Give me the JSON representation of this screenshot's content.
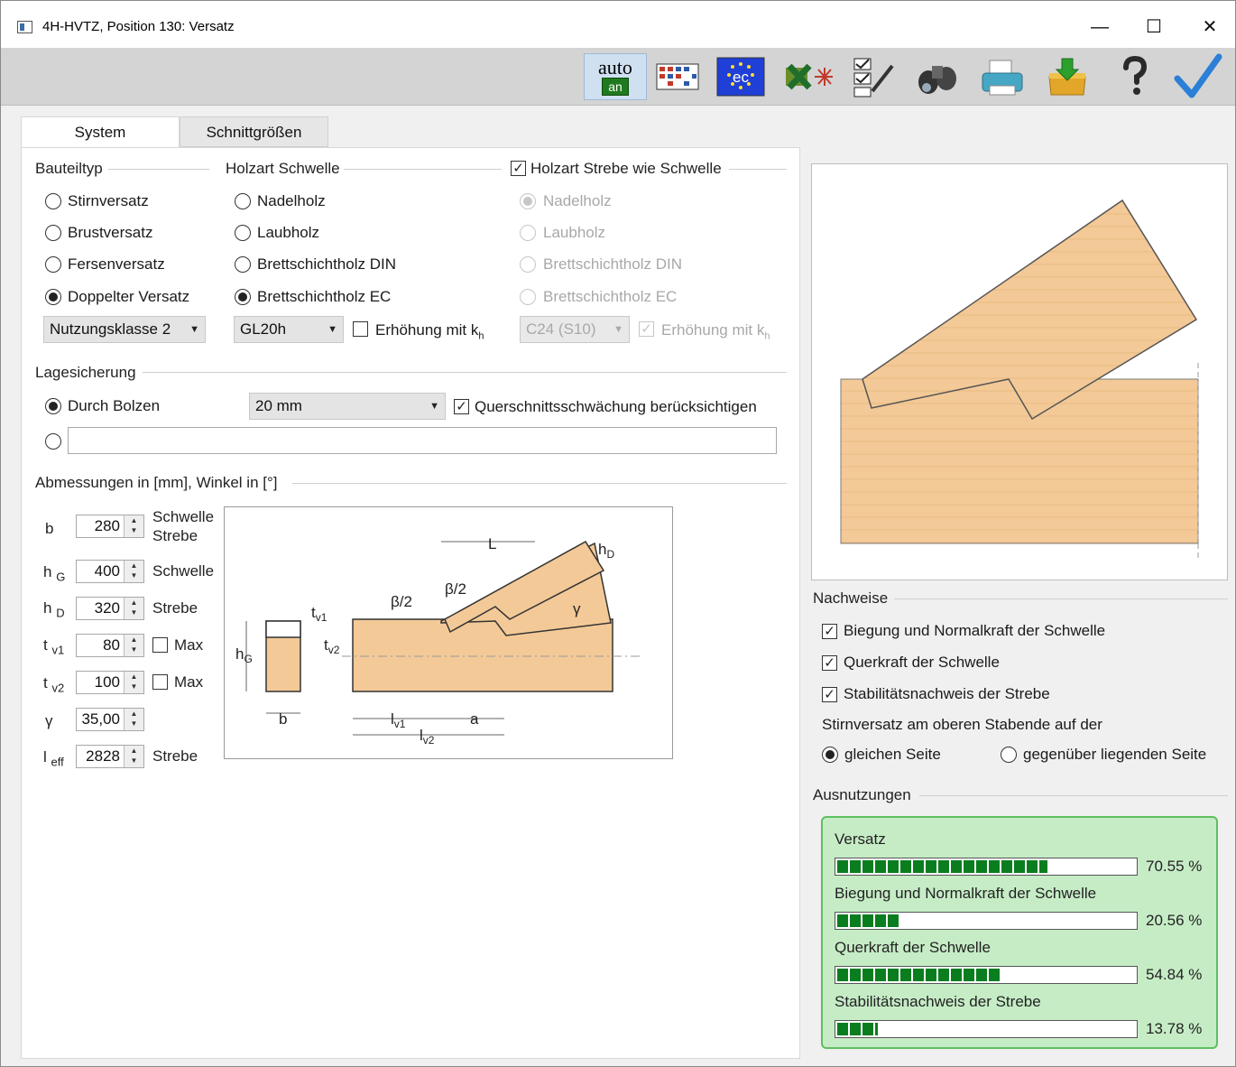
{
  "window": {
    "title": "4H-HVTZ, Position 130: Versatz",
    "min": "—",
    "max": "☐",
    "close": "✕"
  },
  "toolbar": {
    "auto_label": "auto",
    "an_label": "an",
    "icons": [
      "auto-toggle-icon",
      "grid-icon",
      "eurocode-icon",
      "export-icon",
      "checklist-icon",
      "binoculars-icon",
      "printer-icon",
      "save-icon",
      "help-icon",
      "ok-icon"
    ],
    "ec_label": "ec"
  },
  "tabs": {
    "system": "System",
    "schnittgroessen": "Schnittgrößen"
  },
  "bauteiltyp": {
    "label": "Bauteiltyp",
    "options": [
      "Stirnversatz",
      "Brustversatz",
      "Fersenversatz",
      "Doppelter Versatz"
    ],
    "selected": 3,
    "nutzungsklasse": "Nutzungsklasse 2"
  },
  "holzart_schwelle": {
    "label": "Holzart Schwelle",
    "options": [
      "Nadelholz",
      "Laubholz",
      "Brettschichtholz DIN",
      "Brettschichtholz EC"
    ],
    "selected": 3,
    "grade": "GL20h",
    "erhoehung": "Erhöhung mit k",
    "erhoehung_sub": "h"
  },
  "holzart_strebe": {
    "label": "Holzart Strebe wie Schwelle",
    "checked": true,
    "options": [
      "Nadelholz",
      "Laubholz",
      "Brettschichtholz DIN",
      "Brettschichtholz EC"
    ],
    "selected": 0,
    "grade": "C24 (S10)",
    "erhoehung": "Erhöhung mit k",
    "erhoehung_sub": "h"
  },
  "lagesicherung": {
    "label": "Lagesicherung",
    "option1": "Durch Bolzen",
    "bolt": "20 mm",
    "querschnitt": "Querschnittsschwächung berücksichtigen",
    "custom_value": ""
  },
  "abmessungen": {
    "label": "Abmessungen in [mm], Winkel in [°]",
    "rows": [
      {
        "symbol": "b",
        "sub": "",
        "value": "280",
        "note": "Schwelle\nStrebe"
      },
      {
        "symbol": "h",
        "sub": "G",
        "value": "400",
        "note": "Schwelle"
      },
      {
        "symbol": "h",
        "sub": "D",
        "value": "320",
        "note": "Strebe"
      },
      {
        "symbol": "t",
        "sub": "v1",
        "value": "80",
        "note": "Max"
      },
      {
        "symbol": "t",
        "sub": "v2",
        "value": "100",
        "note": "Max"
      },
      {
        "symbol": "γ",
        "sub": "",
        "value": "35,00",
        "note": ""
      },
      {
        "symbol": "l",
        "sub": "eff",
        "value": "2828",
        "note": "Strebe"
      }
    ]
  },
  "drawing_labels": {
    "L": "L",
    "hD": "h",
    "hD_sub": "D",
    "beta1": "β/2",
    "beta2": "β/2",
    "gamma": "γ",
    "tv1": "t",
    "tv1_sub": "v1",
    "tv2": "t",
    "tv2_sub": "v2",
    "hG": "h",
    "hG_sub": "G",
    "b": "b",
    "lv1": "l",
    "lv1_sub": "v1",
    "lv2": "l",
    "lv2_sub": "v2",
    "a": "a"
  },
  "nachweise": {
    "label": "Nachweise",
    "items": [
      "Biegung und Normalkraft der Schwelle",
      "Querkraft der Schwelle",
      "Stabilitätsnachweis der Strebe"
    ],
    "stirn_label": "Stirnversatz am oberen Stabende auf der",
    "opt_gleich": "gleichen Seite",
    "opt_gegen": "gegenüber liegenden Seite"
  },
  "ausnutzungen": {
    "label": "Ausnutzungen",
    "items": [
      {
        "name": "Versatz",
        "pct": "70.55 %",
        "value": 0.7055
      },
      {
        "name": "Biegung und Normalkraft der Schwelle",
        "pct": "20.56 %",
        "value": 0.2056
      },
      {
        "name": "Querkraft der Schwelle",
        "pct": "54.84 %",
        "value": 0.5484
      },
      {
        "name": "Stabilitätsnachweis der Strebe",
        "pct": "13.78 %",
        "value": 0.1378
      }
    ],
    "bar_color": "#0a7d1f",
    "box_color": "#c6ecc6"
  },
  "colors": {
    "wood": "#f3c997",
    "wood_edge": "#333333"
  }
}
